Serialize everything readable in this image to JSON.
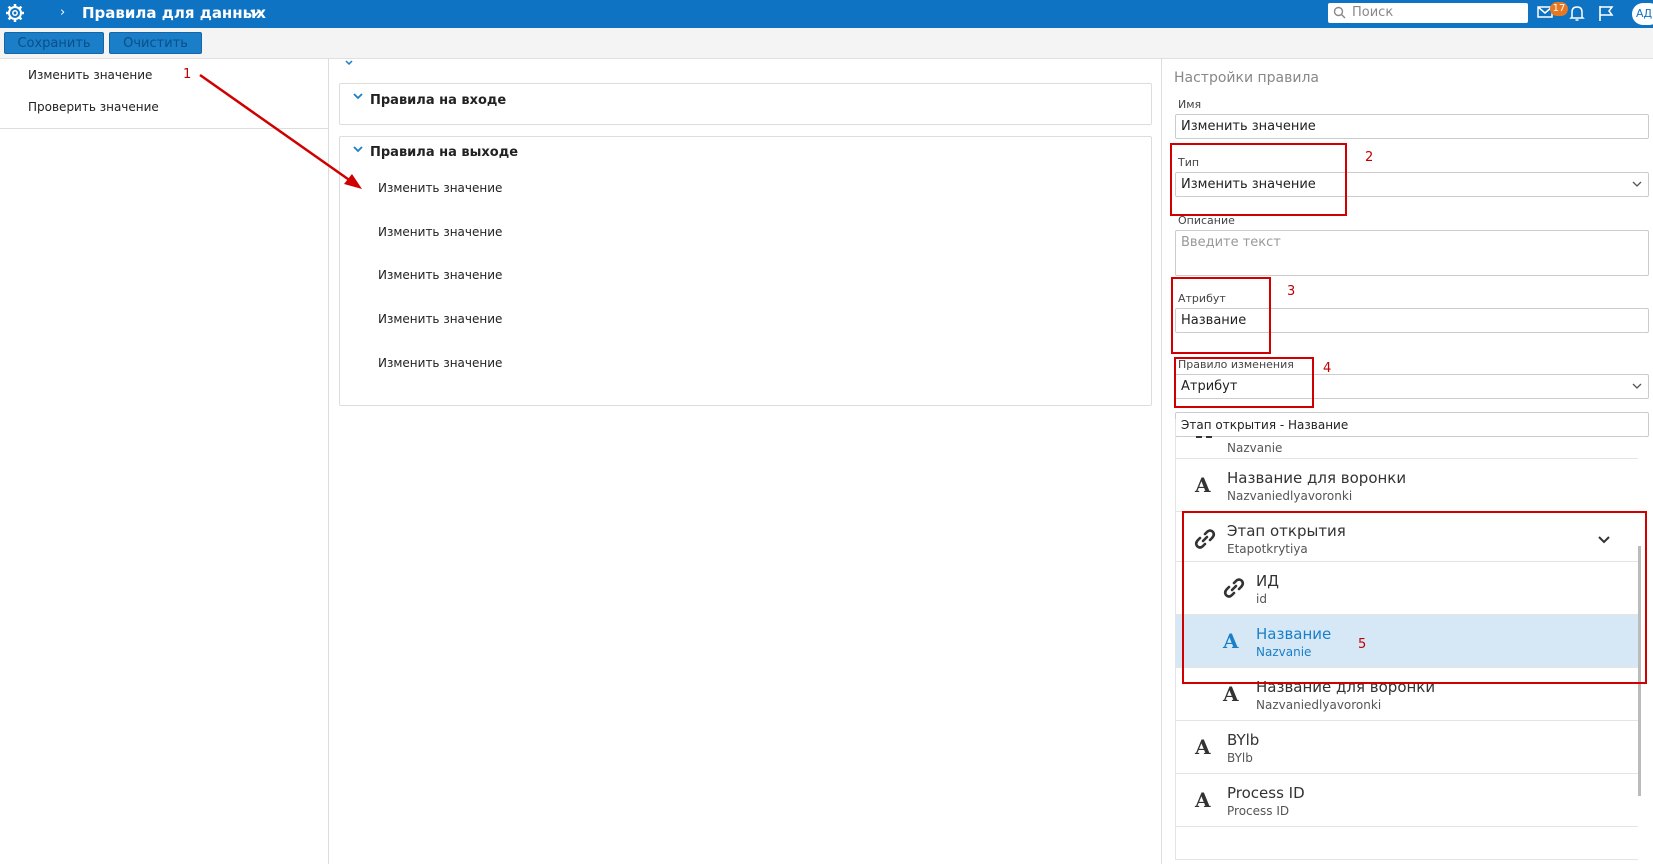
{
  "header": {
    "title": "Правила для данных",
    "search_placeholder": "Поиск",
    "mail_count": "17",
    "avatar_initials": "АД"
  },
  "toolbar": {
    "save_label": "Сохранить",
    "clear_label": "Очистить"
  },
  "left_list": {
    "items": [
      "Изменить значение",
      "Проверить значение"
    ]
  },
  "sections": {
    "input": {
      "title": "Правила на входе"
    },
    "output": {
      "title": "Правила на выходе",
      "items": [
        "Изменить значение",
        "Изменить значение",
        "Изменить значение",
        "Изменить значение",
        "Изменить значение"
      ]
    }
  },
  "settings": {
    "title": "Настройки правила",
    "name_label": "Имя",
    "name_value": "Изменить значение",
    "type_label": "Тип",
    "type_value": "Изменить значение",
    "desc_label": "Описание",
    "desc_placeholder": "Введите текст",
    "attr_label": "Атрибут",
    "attr_value": "Название",
    "rule_label": "Правило изменения",
    "rule_value": "Атрибут",
    "path_value": "Этап открытия - Название"
  },
  "attribute_list": {
    "partial_top_sub": "Nazvanie",
    "items": [
      {
        "name": "Название для воронки",
        "sub": "Nazvaniedlyavoronki",
        "icon": "text-a-icon"
      },
      {
        "name": "Этап открытия",
        "sub": "Etapotkrytiya",
        "icon": "link-icon"
      },
      {
        "name": "ИД",
        "sub": "id",
        "icon": "link-icon"
      },
      {
        "name": "Название",
        "sub": "Nazvanie",
        "icon": "text-a-icon"
      },
      {
        "name": "Название для воронки",
        "sub": "Nazvaniedlyavoronki",
        "icon": "text-a-icon"
      },
      {
        "name": "BYlb",
        "sub": "BYlb",
        "icon": "text-a-icon"
      },
      {
        "name": "Process ID",
        "sub": "Process ID",
        "icon": "text-a-icon"
      }
    ]
  },
  "annotations": {
    "numbers": [
      "1",
      "2",
      "3",
      "4",
      "5"
    ],
    "color": "#d00000"
  },
  "colors": {
    "brand": "#0f73c3",
    "selected_row": "#d6e8f5"
  }
}
